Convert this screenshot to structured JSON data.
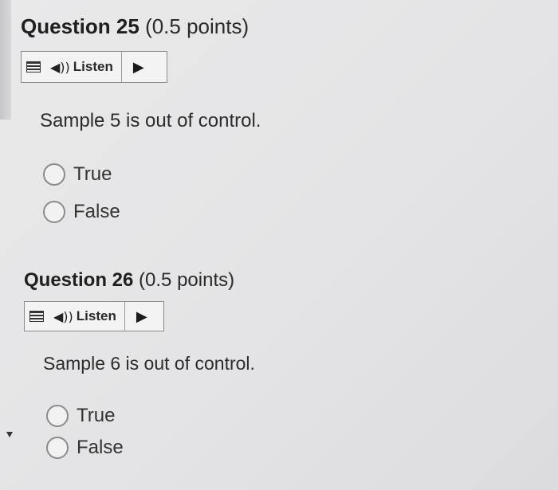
{
  "questions": [
    {
      "title": "Question 25",
      "points": "(0.5 points)",
      "listen_label": "Listen",
      "prompt": "Sample 5 is out of control.",
      "options": [
        "True",
        "False"
      ]
    },
    {
      "title": "Question 26",
      "points": "(0.5 points)",
      "listen_label": "Listen",
      "prompt": "Sample 6 is out of control.",
      "options": [
        "True",
        "False"
      ]
    }
  ],
  "icons": {
    "menu": "menu-icon",
    "speaker": "speaker-icon",
    "play": "play-icon",
    "radio": "radio-button",
    "scroll": "caret-down-icon"
  }
}
